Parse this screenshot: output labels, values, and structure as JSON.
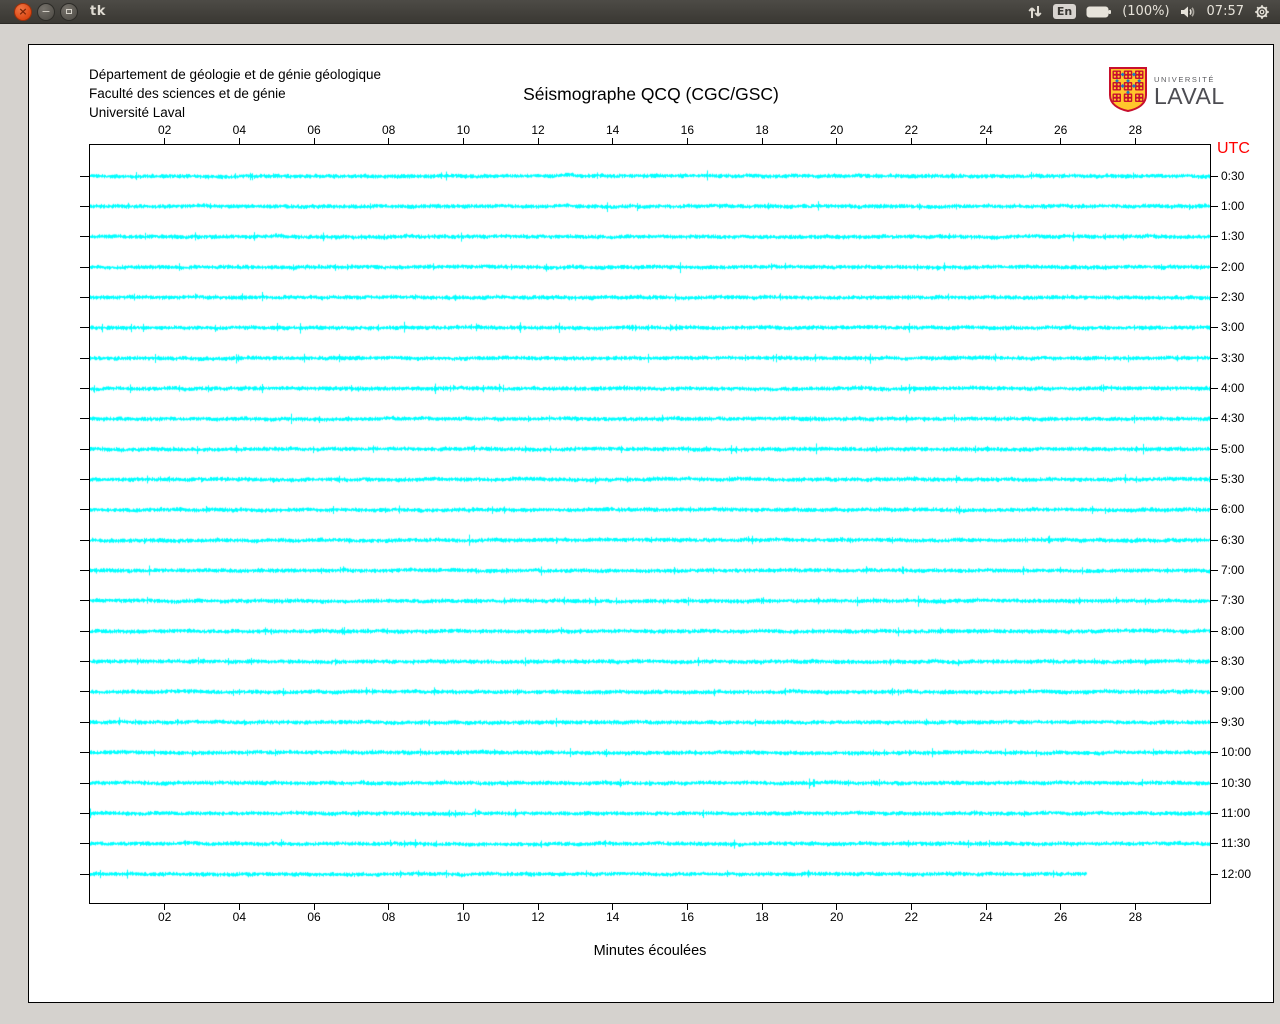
{
  "desktop": {
    "titlebar": {
      "title": "tk",
      "close_glyph": "×",
      "minimize_glyph": "−",
      "tray": {
        "keyboard_layout": "En",
        "battery_percent": "(100%)",
        "clock": "07:57"
      }
    }
  },
  "window": {
    "header_lines": [
      "Département de géologie et de génie géologique",
      "Faculté des sciences et de génie",
      "Université Laval"
    ],
    "logo": {
      "line1": "UNIVERSITÉ",
      "line2": "LAVAL",
      "shield_red": "#c8102e",
      "shield_gold": "#ffc72c",
      "shield_blue": "#1f7bbf"
    }
  },
  "chart_data": {
    "type": "line",
    "title": "Séismographe QCQ (CGC/GSC)",
    "xlabel": "Minutes écoulées",
    "right_axis_label": "UTC",
    "right_axis_label_color": "#ff0000",
    "trace_color": "#00ffff",
    "x_range_minutes": [
      0,
      30
    ],
    "x_ticks": [
      "02",
      "04",
      "06",
      "08",
      "10",
      "12",
      "14",
      "16",
      "18",
      "20",
      "22",
      "24",
      "26",
      "28"
    ],
    "waveform": "continuous low-amplitude background seismic noise on every trace",
    "rows": [
      {
        "utc": "0:30",
        "end_minute": 30
      },
      {
        "utc": "1:00",
        "end_minute": 30
      },
      {
        "utc": "1:30",
        "end_minute": 30
      },
      {
        "utc": "2:00",
        "end_minute": 30
      },
      {
        "utc": "2:30",
        "end_minute": 30
      },
      {
        "utc": "3:00",
        "end_minute": 30
      },
      {
        "utc": "3:30",
        "end_minute": 30
      },
      {
        "utc": "4:00",
        "end_minute": 30
      },
      {
        "utc": "4:30",
        "end_minute": 30
      },
      {
        "utc": "5:00",
        "end_minute": 30
      },
      {
        "utc": "5:30",
        "end_minute": 30
      },
      {
        "utc": "6:00",
        "end_minute": 30
      },
      {
        "utc": "6:30",
        "end_minute": 30
      },
      {
        "utc": "7:00",
        "end_minute": 30
      },
      {
        "utc": "7:30",
        "end_minute": 30
      },
      {
        "utc": "8:00",
        "end_minute": 30
      },
      {
        "utc": "8:30",
        "end_minute": 30
      },
      {
        "utc": "9:00",
        "end_minute": 30
      },
      {
        "utc": "9:30",
        "end_minute": 30
      },
      {
        "utc": "10:00",
        "end_minute": 30
      },
      {
        "utc": "10:30",
        "end_minute": 30
      },
      {
        "utc": "11:00",
        "end_minute": 30
      },
      {
        "utc": "11:30",
        "end_minute": 30
      },
      {
        "utc": "12:00",
        "end_minute": 26.7
      }
    ]
  }
}
